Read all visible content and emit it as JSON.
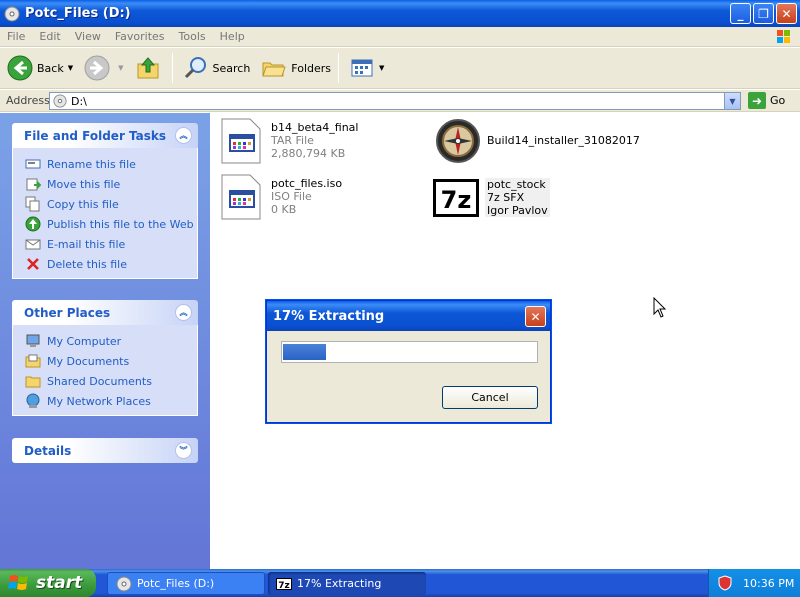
{
  "window": {
    "title": "Potc_Files (D:)",
    "minimize": "_",
    "maximize": "❐",
    "close": "✕"
  },
  "menu": [
    "File",
    "Edit",
    "View",
    "Favorites",
    "Tools",
    "Help"
  ],
  "toolbar": {
    "back": "Back",
    "search": "Search",
    "folders": "Folders"
  },
  "address": {
    "label": "Address",
    "value": "D:\\",
    "go": "Go"
  },
  "left_pane": {
    "file_tasks": {
      "title": "File and Folder Tasks",
      "items": [
        {
          "label": "Rename this file",
          "icon": "rename-icon"
        },
        {
          "label": "Move this file",
          "icon": "move-icon"
        },
        {
          "label": "Copy this file",
          "icon": "copy-icon"
        },
        {
          "label": "Publish this file to the Web",
          "icon": "publish-icon"
        },
        {
          "label": "E-mail this file",
          "icon": "email-icon"
        },
        {
          "label": "Delete this file",
          "icon": "delete-icon"
        }
      ]
    },
    "other_places": {
      "title": "Other Places",
      "items": [
        {
          "label": "My Computer",
          "icon": "computer-icon"
        },
        {
          "label": "My Documents",
          "icon": "documents-icon"
        },
        {
          "label": "Shared Documents",
          "icon": "shared-folder-icon"
        },
        {
          "label": "My Network Places",
          "icon": "network-icon"
        }
      ]
    },
    "details": {
      "title": "Details"
    }
  },
  "files": [
    {
      "name": "b14_beta4_final",
      "line2": "TAR File",
      "line3": "2,880,794 KB",
      "icon": "generic-file-icon"
    },
    {
      "name": "Build14_installer_31082017",
      "line2": "",
      "line3": "",
      "icon": "compass-icon"
    },
    {
      "name": "potc_files.iso",
      "line2": "ISO File",
      "line3": "0 KB",
      "icon": "generic-file-icon"
    },
    {
      "name": "potc_stock",
      "line2": "7z SFX",
      "line3": "Igor Pavlov",
      "icon": "7zip-icon"
    }
  ],
  "dialog": {
    "title": "17% Extracting",
    "progress_percent": 17,
    "cancel": "Cancel"
  },
  "taskbar": {
    "start": "start",
    "items": [
      {
        "label": "Potc_Files (D:)"
      },
      {
        "label": "17% Extracting"
      }
    ],
    "clock": "10:36 PM"
  },
  "colors": {
    "titlebar_blue": "#0a4fd0",
    "task_link": "#215dc6",
    "taskbar_blue": "#2157d7",
    "start_green": "#3a9a3a"
  }
}
